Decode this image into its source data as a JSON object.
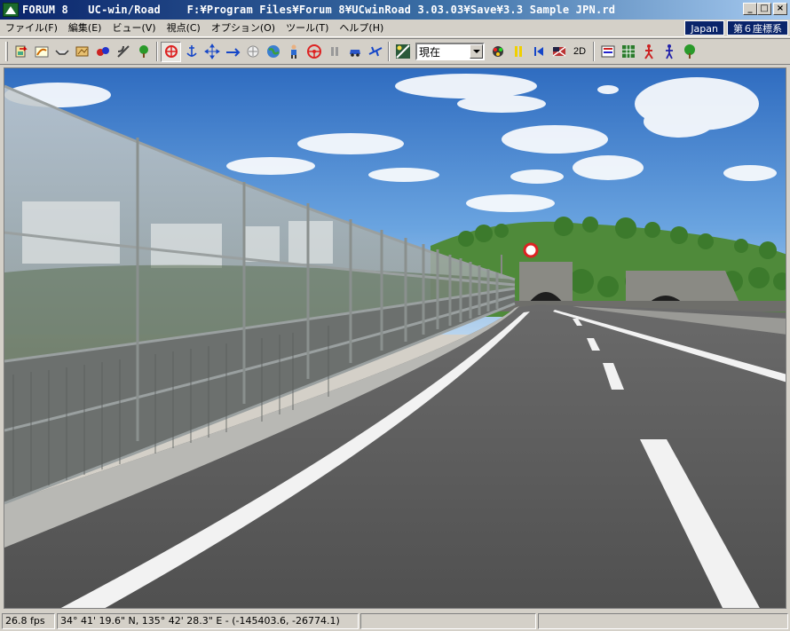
{
  "window": {
    "app_name": "FORUM 8",
    "title": "   UC-win/Road    F:¥Program Files¥Forum 8¥UCwinRoad 3.03.03¥Save¥3.3 Sample JPN.rd",
    "minimize_glyph": "_",
    "maximize_glyph": "□",
    "close_glyph": "×"
  },
  "menubar": {
    "items": [
      {
        "label": "ファイル(F)"
      },
      {
        "label": "編集(E)"
      },
      {
        "label": "ビュー(V)"
      },
      {
        "label": "視点(C)"
      },
      {
        "label": "オプション(O)"
      },
      {
        "label": "ツール(T)"
      },
      {
        "label": "ヘルプ(H)"
      }
    ],
    "region": "Japan",
    "coord_system": "第６座標系"
  },
  "toolbar": {
    "time_combo_value": "現在",
    "mode_2d_label": "2D",
    "icons": [
      "import-icon",
      "road-edit-icon",
      "cross-section-icon",
      "terrain-icon",
      "traffic-icon",
      "intersection-icon",
      "tree-icon",
      "move-mode-icon",
      "anchor-icon",
      "move-cross-icon",
      "fly-icon",
      "walk-icon",
      "globe-icon",
      "person-icon",
      "steering-wheel-icon",
      "pause-icon",
      "car-icon",
      "airplane-icon",
      "sun-time-icon",
      "signal-icon",
      "yellow-pause-icon",
      "skip-back-icon",
      "flag-icon",
      "panel-icon",
      "grid-icon",
      "pedestrian-red-icon",
      "pedestrian-blue-icon",
      "tree-green-icon"
    ]
  },
  "viewport": {
    "sky_color": "#4a86d0",
    "road_color": "#5c5c5c"
  },
  "statusbar": {
    "fps": "26.8 fps",
    "coordinates": "34°  41' 19.6\" N, 135°  42' 28.3\" E  -  (-145403.6, -26774.1)",
    "panel3": "",
    "panel4": ""
  }
}
